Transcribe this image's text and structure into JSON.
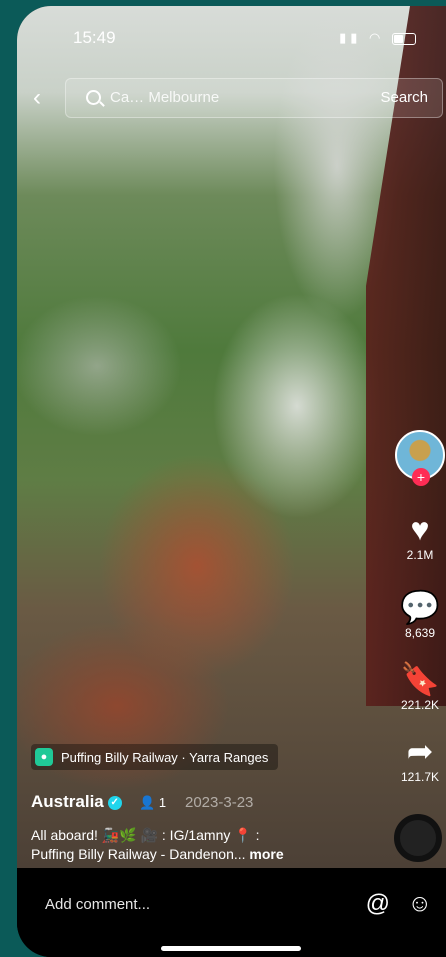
{
  "status_bar": {
    "time": "15:49"
  },
  "search": {
    "query": "Ca…     Melbourne",
    "button_label": "Search"
  },
  "sidebar": {
    "like_count": "2.1M",
    "comment_count": "8,639",
    "save_count": "221.2K",
    "share_count": "121.7K"
  },
  "post": {
    "location": "Puffing Billy Railway · Yarra Ranges",
    "author": "Australia",
    "collab_count": "1",
    "date": "2023-3-23",
    "caption_line1": "All aboard! 🚂🌿  🎥 : IG/1amny  📍 :",
    "caption_line2": "Puffing Billy Railway - Dandenon...",
    "more_label": "more"
  },
  "comment_bar": {
    "placeholder": "Add comment..."
  },
  "colors": {
    "accent": "#fe2c55",
    "location_pin": "#20c997",
    "verified": "#20d5ec"
  }
}
